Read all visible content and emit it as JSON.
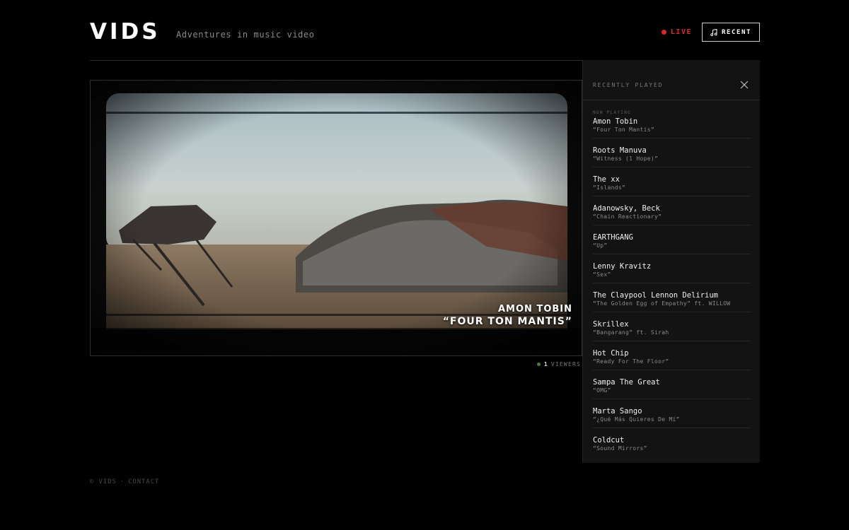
{
  "header": {
    "logo": "VIDS",
    "tagline": "Adventures in music video",
    "live_label": "LIVE",
    "recent_label": "RECENT"
  },
  "video": {
    "artist": "AMON TOBIN",
    "title": "“FOUR TON MANTIS”"
  },
  "viewers": {
    "count": "1",
    "label": "VIEWERS"
  },
  "panel": {
    "title": "RECENTLY PLAYED",
    "now_playing_label": "NOW PLAYING",
    "tracks": [
      {
        "artist": "Amon Tobin",
        "title": "“Four Ton Mantis”"
      },
      {
        "artist": "Roots Manuva",
        "title": "“Witness (1 Hope)”"
      },
      {
        "artist": "The xx",
        "title": "“Islands”"
      },
      {
        "artist": "Adanowsky, Beck",
        "title": "“Chain Reactionary”"
      },
      {
        "artist": "EARTHGANG",
        "title": "“Up”"
      },
      {
        "artist": "Lenny Kravitz",
        "title": "“Sex”"
      },
      {
        "artist": "The Claypool Lennon Delirium",
        "title": "“The Golden Egg of Empathy” ft. WILLOW"
      },
      {
        "artist": "Skrillex",
        "title": "“Bangarang” ft. Sirah"
      },
      {
        "artist": "Hot Chip",
        "title": "“Ready For The Floor”"
      },
      {
        "artist": "Sampa The Great",
        "title": "“OMG”"
      },
      {
        "artist": "Marta Sango",
        "title": "“¿Qué Más Quieres De Mí”"
      },
      {
        "artist": "Coldcut",
        "title": "“Sound Mirrors”"
      }
    ]
  },
  "footer": {
    "copyright": "© VIDS",
    "separator": "·",
    "contact": "CONTACT"
  },
  "colors": {
    "accent_live": "#e0262b",
    "viewer_dot": "#4c7a3c",
    "panel_bg": "#131313"
  },
  "icons": {
    "recent": "music-note-icon",
    "close": "close-icon",
    "live": "live-dot-icon"
  }
}
